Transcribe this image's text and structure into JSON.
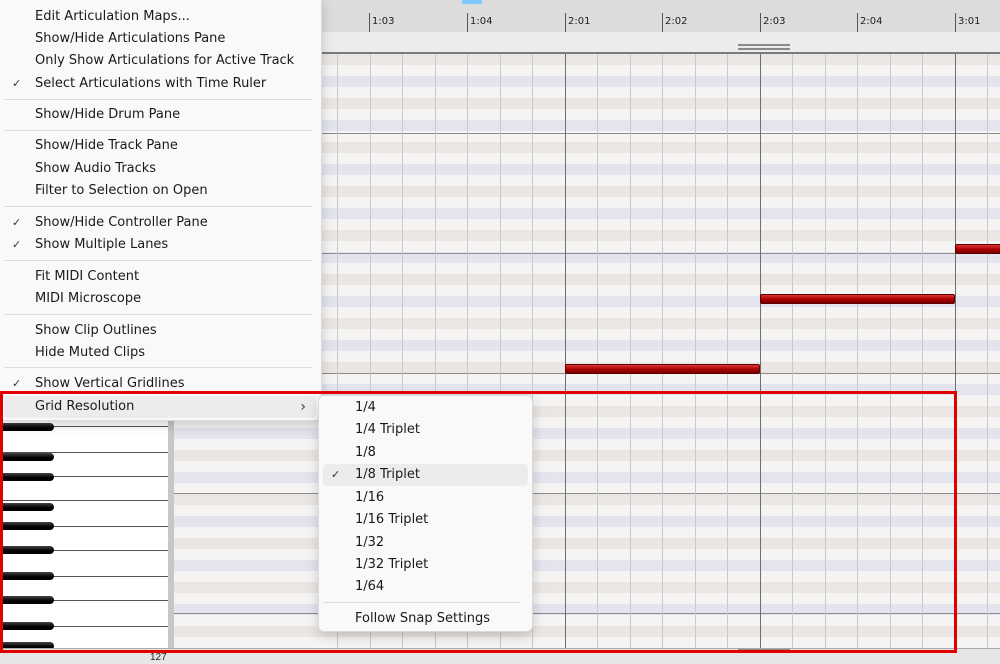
{
  "ruler": {
    "labels": [
      "1:03",
      "1:04",
      "2:01",
      "2:02",
      "2:03",
      "2:04",
      "3:01"
    ]
  },
  "keyboard": {
    "bottom_label": "127"
  },
  "notes": [
    {
      "start": "2:01",
      "end": "2:03"
    },
    {
      "start": "2:03",
      "end": "3:01"
    },
    {
      "start": "3:01",
      "end": ""
    }
  ],
  "menu": {
    "items": [
      {
        "label": "Edit Articulation Maps...",
        "checked": false
      },
      {
        "label": "Show/Hide Articulations Pane",
        "checked": false
      },
      {
        "label": "Only Show Articulations for Active Track",
        "checked": false
      },
      {
        "label": "Select Articulations with Time Ruler",
        "checked": true
      },
      {
        "label": "Show/Hide Drum Pane",
        "checked": false
      },
      {
        "label": "Show/Hide Track Pane",
        "checked": false
      },
      {
        "label": "Show Audio Tracks",
        "checked": false
      },
      {
        "label": "Filter to Selection on Open",
        "checked": false
      },
      {
        "label": "Show/Hide Controller Pane",
        "checked": true
      },
      {
        "label": "Show Multiple Lanes",
        "checked": true
      },
      {
        "label": "Fit MIDI Content",
        "checked": false
      },
      {
        "label": "MIDI Microscope",
        "checked": false
      },
      {
        "label": "Show Clip Outlines",
        "checked": false
      },
      {
        "label": "Hide Muted Clips",
        "checked": false
      },
      {
        "label": "Show Vertical Gridlines",
        "checked": true
      },
      {
        "label": "Grid Resolution",
        "checked": false,
        "submenu": true
      }
    ],
    "check_glyph": "✓",
    "submenu_arrow": "›"
  },
  "submenu": {
    "items": [
      {
        "label": "1/4",
        "checked": false
      },
      {
        "label": "1/4 Triplet",
        "checked": false
      },
      {
        "label": "1/8",
        "checked": false
      },
      {
        "label": "1/8 Triplet",
        "checked": true
      },
      {
        "label": "1/16",
        "checked": false
      },
      {
        "label": "1/16 Triplet",
        "checked": false
      },
      {
        "label": "1/32",
        "checked": false
      },
      {
        "label": "1/32 Triplet",
        "checked": false
      },
      {
        "label": "1/64",
        "checked": false
      },
      {
        "label": "Follow Snap Settings",
        "checked": false
      }
    ]
  },
  "colors": {
    "note": "#aa0000",
    "highlight": "#e00000",
    "playhead": "#7ec8ff"
  }
}
